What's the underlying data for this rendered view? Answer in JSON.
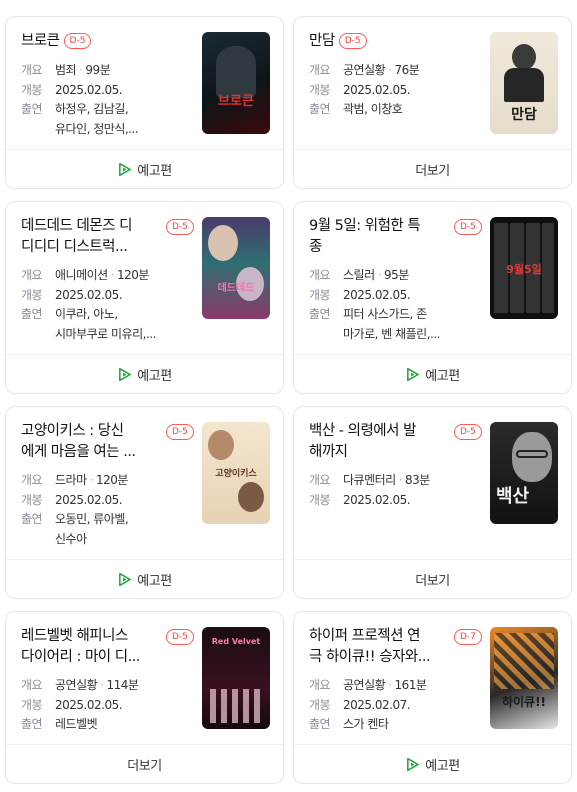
{
  "labels": {
    "summary": "개요",
    "release": "개봉",
    "cast": "출연"
  },
  "colors": {
    "accent": "#1aa33a",
    "badge": "#ff3c3c",
    "border": "#e4e6ea",
    "label": "#8a8f99"
  },
  "cards": [
    {
      "title": "브로큰",
      "dday": "D-5",
      "genre": "범죄",
      "runtime": "99분",
      "date": "2025.02.05.",
      "cast_1": "하정우, 김남길,",
      "cast_2": "유다인, 정만식,...",
      "footer": "예고편",
      "footer_icon": "play-icon",
      "poster_text": "브로큰"
    },
    {
      "title": "만담",
      "dday": "D-5",
      "genre": "공연실황",
      "runtime": "76분",
      "date": "2025.02.05.",
      "cast_1": "곽범, 이창호",
      "footer": "더보기",
      "poster_text": "만담"
    },
    {
      "title_1": "데드데드 데몬즈 디",
      "title_2": "디디디 디스트럭...",
      "dday": "D-5",
      "genre": "애니메이션",
      "runtime": "120분",
      "date": "2025.02.05.",
      "cast_1": "이쿠라, 아노,",
      "cast_2": "시마부쿠로 미유리,...",
      "footer": "예고편",
      "footer_icon": "play-icon",
      "poster_text": "데드데드"
    },
    {
      "title_1": "9월 5일: 위험한 특",
      "title_2": "종",
      "dday": "D-5",
      "genre": "스릴러",
      "runtime": "95분",
      "date": "2025.02.05.",
      "cast_1": "피터 사스가드, 존",
      "cast_2": "마가로, 벤 채플린,...",
      "footer": "예고편",
      "footer_icon": "play-icon",
      "poster_text": "9월5일"
    },
    {
      "title_1": "고양이키스 : 당신",
      "title_2": "에게 마음을 여는 ...",
      "dday": "D-5",
      "genre": "드라마",
      "runtime": "120분",
      "date": "2025.02.05.",
      "cast_1": "오동민, 류아벨,",
      "cast_2": "신수아",
      "footer": "예고편",
      "footer_icon": "play-icon",
      "poster_text": "고양이키스"
    },
    {
      "title_1": "백산 - 의령에서 발",
      "title_2": "해까지",
      "dday": "D-5",
      "genre": "다큐멘터리",
      "runtime": "83분",
      "date": "2025.02.05.",
      "footer": "더보기",
      "poster_text": "백산"
    },
    {
      "title_1": "레드벨벳 해피니스",
      "title_2": "다이어리 : 마이 디...",
      "dday": "D-5",
      "genre": "공연실황",
      "runtime": "114분",
      "date": "2025.02.05.",
      "cast_1": "레드벨벳",
      "footer": "더보기",
      "poster_text": "Red Velvet"
    },
    {
      "title_1": "하이퍼 프로젝션 연",
      "title_2": "극 하이큐!! 승자와...",
      "dday": "D-7",
      "genre": "공연실황",
      "runtime": "161분",
      "date": "2025.02.07.",
      "cast_1": "스가 켄타",
      "footer": "예고편",
      "footer_icon": "play-icon",
      "poster_text": "하이큐!!"
    }
  ]
}
